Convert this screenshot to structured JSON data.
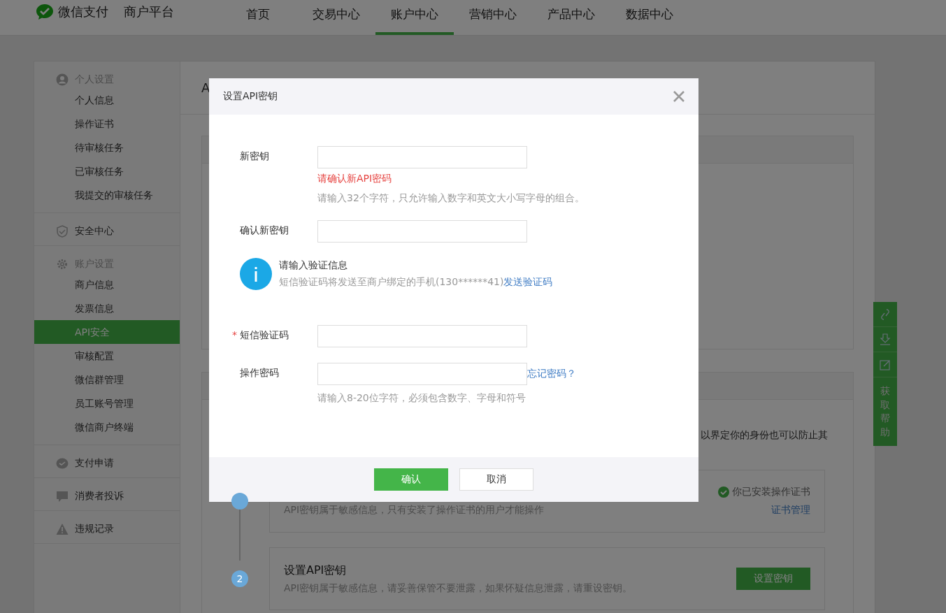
{
  "header": {
    "logo_text": "微信支付",
    "platform": "商户平台",
    "nav": [
      {
        "label": "首页",
        "selected": false
      },
      {
        "label": "交易中心",
        "selected": false
      },
      {
        "label": "账户中心",
        "selected": true
      },
      {
        "label": "营销中心",
        "selected": false
      },
      {
        "label": "产品中心",
        "selected": false
      },
      {
        "label": "数据中心",
        "selected": false
      }
    ]
  },
  "sidebar": [
    {
      "kind": "group",
      "title": "个人设置",
      "items": [
        {
          "label": "个人信息",
          "selected": false
        },
        {
          "label": "操作证书",
          "selected": false
        },
        {
          "label": "待审核任务",
          "selected": false
        },
        {
          "label": "已审核任务",
          "selected": false
        },
        {
          "label": "我提交的审核任务",
          "selected": false
        }
      ]
    },
    {
      "kind": "link",
      "title": "安全中心"
    },
    {
      "kind": "group",
      "title": "账户设置",
      "items": [
        {
          "label": "商户信息",
          "selected": false
        },
        {
          "label": "发票信息",
          "selected": false
        },
        {
          "label": "API安全",
          "selected": true
        },
        {
          "label": "审核配置",
          "selected": false
        },
        {
          "label": "微信群管理",
          "selected": false
        },
        {
          "label": "员工账号管理",
          "selected": false
        },
        {
          "label": "微信商户终端",
          "selected": false
        }
      ]
    },
    {
      "kind": "link",
      "title": "支付申请"
    },
    {
      "kind": "link",
      "title": "消费者投诉"
    },
    {
      "kind": "link",
      "title": "违规记录"
    }
  ],
  "main": {
    "title": "A",
    "notice": "以界定你的身份也可以防止其",
    "steps": [
      {
        "description": "API密钥属于敏感信息，只有安装了操作证书的用户才能操作",
        "status": "你已安装操作证书",
        "link": "证书管理"
      },
      {
        "number": "2",
        "title": "设置API密钥",
        "description": "API密钥属于敏感信息，请妥善保管不要泄露，如果怀疑信息泄露，请重设密钥。",
        "button": "设置密钥"
      }
    ]
  },
  "help_toolbar": {
    "label": "获取帮助"
  },
  "dialog": {
    "title": "设置API密钥",
    "rows": [
      {
        "kind": "field",
        "label": "新密钥",
        "error": "请确认新API密码",
        "hint": "请输入32个字符，只允许输入数字和英文大小写字母的组合。"
      },
      {
        "kind": "field",
        "label": "确认新密钥"
      },
      {
        "kind": "info",
        "title": "请输入验证信息",
        "text": "短信验证码将发送至商户绑定的手机(130******41)",
        "link": "发送验证码"
      },
      {
        "kind": "field",
        "label": "短信验证码",
        "required_mark": "*"
      },
      {
        "kind": "field",
        "label": "操作密码",
        "link": "忘记密码？",
        "hint": "请输入8-20位字符，必须包含数字、字母和符号"
      }
    ],
    "buttons": [
      {
        "label": "确认",
        "primary": true
      },
      {
        "label": "取消",
        "primary": false
      }
    ]
  }
}
